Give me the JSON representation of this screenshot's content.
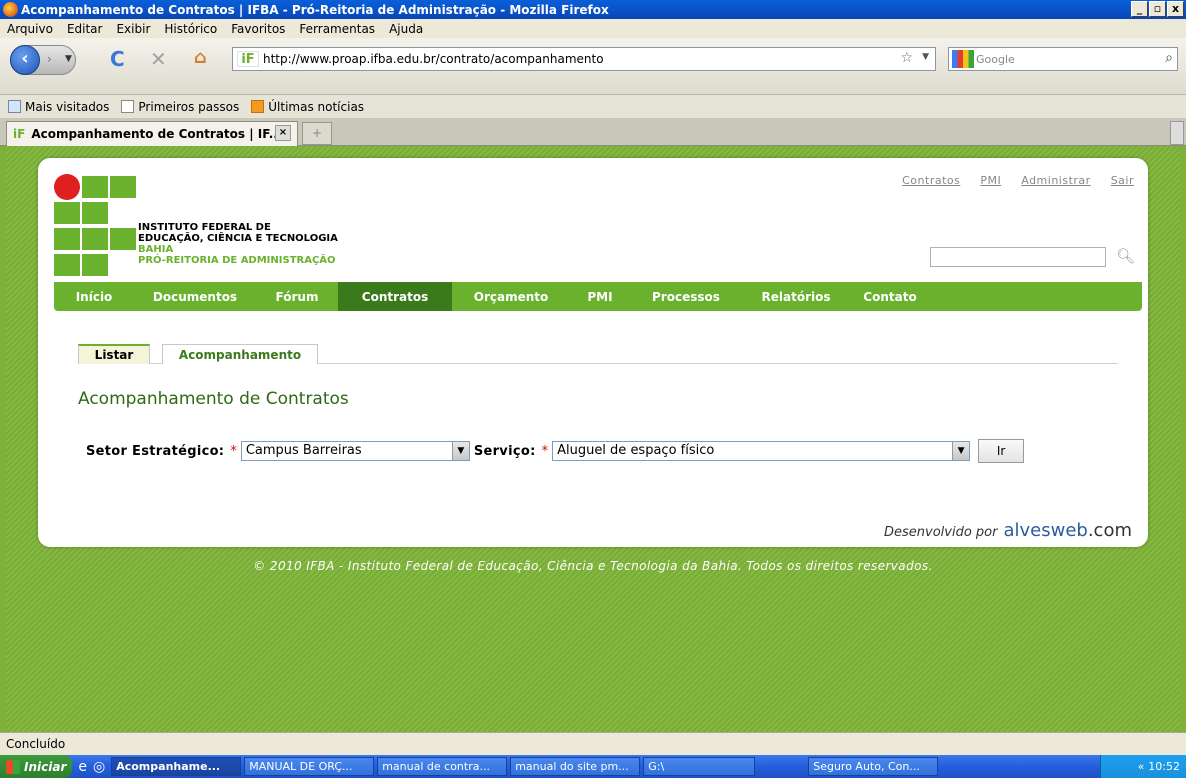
{
  "window": {
    "title": "Acompanhamento de Contratos | IFBA - Pró-Reitoria de Administração - Mozilla Firefox"
  },
  "menu": [
    "Arquivo",
    "Editar",
    "Exibir",
    "Histórico",
    "Favoritos",
    "Ferramentas",
    "Ajuda"
  ],
  "browser": {
    "url": "http://www.proap.ifba.edu.br/contrato/acompanhamento",
    "search_placeholder": "Google",
    "bookmarks": [
      "Mais visitados",
      "Primeiros passos",
      "Últimas notícias"
    ],
    "tab_title": "Acompanhamento de Contratos | IF...",
    "status": "Concluído"
  },
  "site": {
    "logo_lines": [
      "INSTITUTO FEDERAL DE",
      "EDUCAÇÃO, CIÊNCIA E TECNOLOGIA",
      "BAHIA",
      "PRÓ-REITORIA DE ADMINISTRAÇÃO"
    ],
    "top_links": [
      "Contratos",
      "PMI",
      "Administrar",
      "Sair"
    ],
    "nav": [
      "Início",
      "Documentos",
      "Fórum",
      "Contratos",
      "Orçamento",
      "PMI",
      "Processos",
      "Relatórios",
      "Contato"
    ],
    "nav_active": "Contratos",
    "subtabs": [
      "Listar",
      "Acompanhamento"
    ],
    "page_title": "Acompanhamento de Contratos",
    "form": {
      "setor_label": "Setor Estratégico:",
      "setor_value": "Campus Barreiras",
      "servico_label": "Serviço:",
      "servico_value": "Aluguel de espaço físico",
      "required_mark": "*",
      "submit": "Ir"
    },
    "developed_by": "Desenvolvido por",
    "brand": "alvesweb",
    "brand_tld": ".com",
    "copyright": "© 2010 IFBA - Instituto Federal de Educação, Ciência e Tecnologia da Bahia. Todos os direitos reservados."
  },
  "taskbar": {
    "start": "Iniciar",
    "items": [
      "Acompanhame...",
      "MANUAL DE ORÇ...",
      "manual de contra...",
      "manual do site pm...",
      "G:\\",
      "Seguro Auto, Con..."
    ],
    "clock": "10:52"
  }
}
